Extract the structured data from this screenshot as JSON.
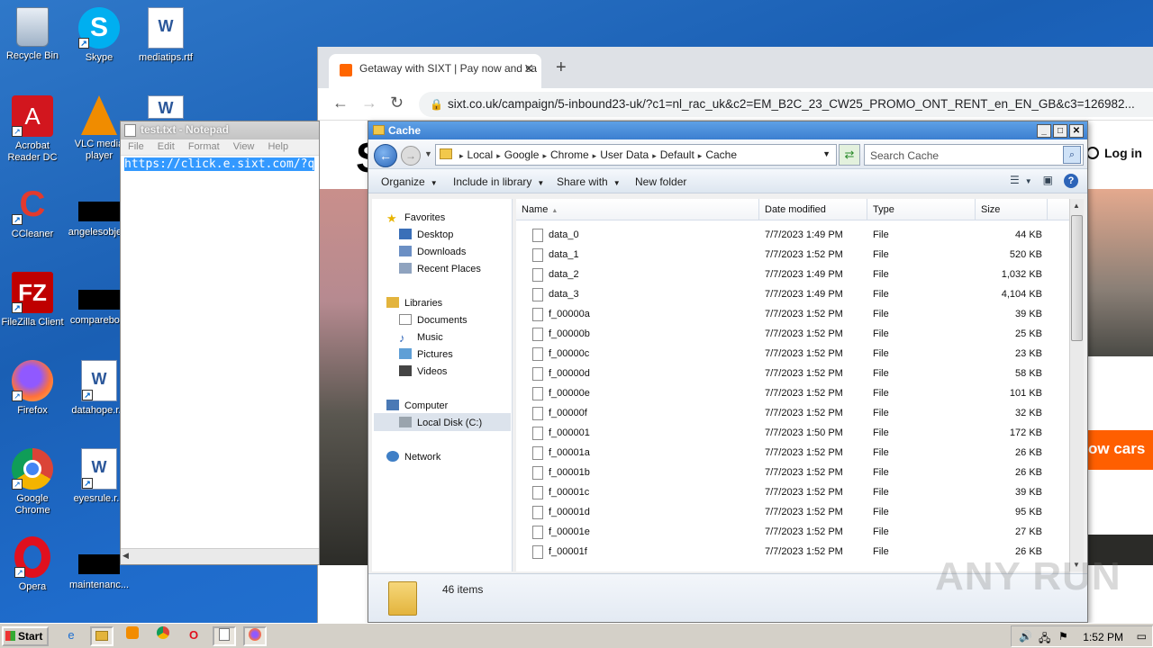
{
  "desktop": {
    "icons": [
      {
        "label": "Recycle Bin"
      },
      {
        "label": "Skype"
      },
      {
        "label": "mediatips.rtf"
      },
      {
        "label": "Acrobat Reader DC"
      },
      {
        "label": "VLC media player"
      },
      {
        "label": "CCleaner"
      },
      {
        "label": "angelesobje..."
      },
      {
        "label": "FileZilla Client"
      },
      {
        "label": "comparebo..."
      },
      {
        "label": "Firefox"
      },
      {
        "label": "datahope.r..."
      },
      {
        "label": "Google Chrome"
      },
      {
        "label": "eyesrule.r..."
      },
      {
        "label": "Opera"
      },
      {
        "label": "maintenanc..."
      }
    ]
  },
  "browser": {
    "tab_title": "Getaway with SIXT | Pay now and sa",
    "url": "sixt.co.uk/campaign/5-inbound23-uk/?c1=nl_rac_uk&c2=EM_B2C_23_CW25_PROMO_ONT_RENT_en_EN_GB&c3=126982...",
    "logo": "S",
    "login": "Log in",
    "promo_button": "ow cars"
  },
  "notepad": {
    "title": "test.txt - Notepad",
    "menu": [
      "File",
      "Edit",
      "Format",
      "View",
      "Help"
    ],
    "content": "https://click.e.sixt.com/?q"
  },
  "explorer": {
    "title": "Cache",
    "breadcrumbs": [
      "Local",
      "Google",
      "Chrome",
      "User Data",
      "Default",
      "Cache"
    ],
    "search_placeholder": "Search Cache",
    "commands": {
      "organize": "Organize",
      "include": "Include in library",
      "share": "Share with",
      "new_folder": "New folder"
    },
    "nav": {
      "favorites": "Favorites",
      "desktop": "Desktop",
      "downloads": "Downloads",
      "recent": "Recent Places",
      "libraries": "Libraries",
      "documents": "Documents",
      "music": "Music",
      "pictures": "Pictures",
      "videos": "Videos",
      "computer": "Computer",
      "localdisk": "Local Disk (C:)",
      "network": "Network"
    },
    "columns": {
      "name": "Name",
      "date": "Date modified",
      "type": "Type",
      "size": "Size"
    },
    "files": [
      {
        "name": "data_0",
        "date": "7/7/2023 1:49 PM",
        "type": "File",
        "size": "44 KB"
      },
      {
        "name": "data_1",
        "date": "7/7/2023 1:52 PM",
        "type": "File",
        "size": "520 KB"
      },
      {
        "name": "data_2",
        "date": "7/7/2023 1:49 PM",
        "type": "File",
        "size": "1,032 KB"
      },
      {
        "name": "data_3",
        "date": "7/7/2023 1:49 PM",
        "type": "File",
        "size": "4,104 KB"
      },
      {
        "name": "f_00000a",
        "date": "7/7/2023 1:52 PM",
        "type": "File",
        "size": "39 KB"
      },
      {
        "name": "f_00000b",
        "date": "7/7/2023 1:52 PM",
        "type": "File",
        "size": "25 KB"
      },
      {
        "name": "f_00000c",
        "date": "7/7/2023 1:52 PM",
        "type": "File",
        "size": "23 KB"
      },
      {
        "name": "f_00000d",
        "date": "7/7/2023 1:52 PM",
        "type": "File",
        "size": "58 KB"
      },
      {
        "name": "f_00000e",
        "date": "7/7/2023 1:52 PM",
        "type": "File",
        "size": "101 KB"
      },
      {
        "name": "f_00000f",
        "date": "7/7/2023 1:52 PM",
        "type": "File",
        "size": "32 KB"
      },
      {
        "name": "f_000001",
        "date": "7/7/2023 1:50 PM",
        "type": "File",
        "size": "172 KB"
      },
      {
        "name": "f_00001a",
        "date": "7/7/2023 1:52 PM",
        "type": "File",
        "size": "26 KB"
      },
      {
        "name": "f_00001b",
        "date": "7/7/2023 1:52 PM",
        "type": "File",
        "size": "26 KB"
      },
      {
        "name": "f_00001c",
        "date": "7/7/2023 1:52 PM",
        "type": "File",
        "size": "39 KB"
      },
      {
        "name": "f_00001d",
        "date": "7/7/2023 1:52 PM",
        "type": "File",
        "size": "95 KB"
      },
      {
        "name": "f_00001e",
        "date": "7/7/2023 1:52 PM",
        "type": "File",
        "size": "27 KB"
      },
      {
        "name": "f_00001f",
        "date": "7/7/2023 1:52 PM",
        "type": "File",
        "size": "26 KB"
      }
    ],
    "item_count": "46 items"
  },
  "watermark": "ANY RUN",
  "taskbar": {
    "start": "Start",
    "clock": "1:52 PM"
  }
}
